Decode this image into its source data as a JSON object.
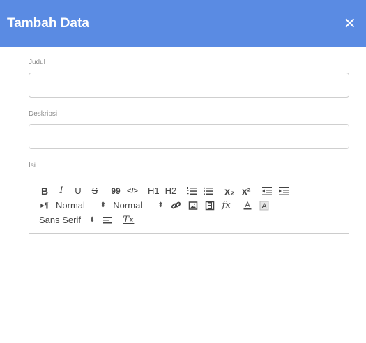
{
  "dialog": {
    "title": "Tambah Data",
    "close_glyph": "✕"
  },
  "fields": {
    "judul": {
      "label": "Judul",
      "value": ""
    },
    "deskripsi": {
      "label": "Deskripsi",
      "value": ""
    },
    "isi": {
      "label": "Isi"
    }
  },
  "toolbar": {
    "bold": "B",
    "italic": "I",
    "underline": "U",
    "strike": "S",
    "blockquote": "99",
    "code": "</>",
    "h1": "H1",
    "h2": "H2",
    "subscript": "x₂",
    "superscript": "x²",
    "direction": "▸¶",
    "size_picker": "Normal",
    "header_picker": "Normal",
    "font_picker": "Sans Serif",
    "formula": "fx",
    "clear_format": "Tx"
  },
  "colors": {
    "header_bg": "#5a8be3",
    "header_text": "#ffffff"
  },
  "icons": [
    "close-icon",
    "ordered-list-icon",
    "bullet-list-icon",
    "indent-decrease-icon",
    "indent-increase-icon",
    "link-icon",
    "image-icon",
    "video-icon",
    "formula-icon",
    "text-color-icon",
    "background-color-icon",
    "align-icon",
    "clear-format-icon"
  ]
}
